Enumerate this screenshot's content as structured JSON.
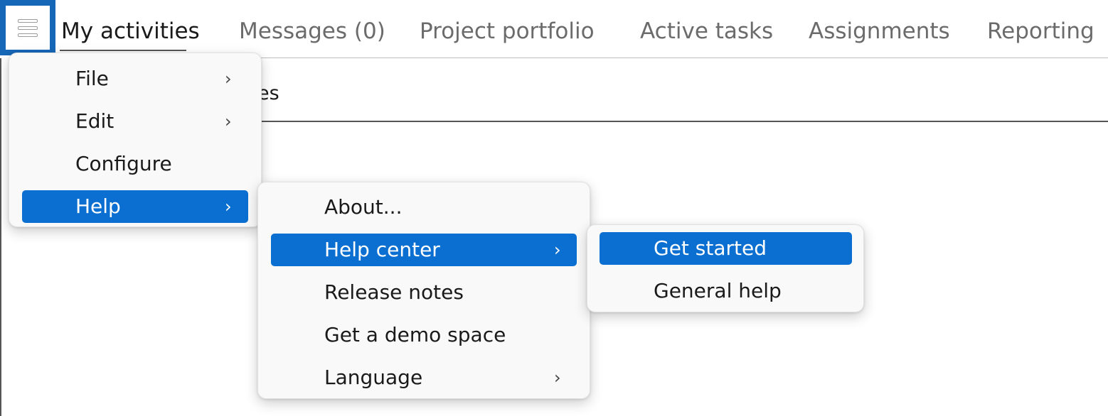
{
  "menu_button": {
    "icon": "hamburger-menu-icon"
  },
  "tabs": [
    {
      "label": "My activities"
    },
    {
      "label": "Messages (0)"
    },
    {
      "label": "Project portfolio"
    },
    {
      "label": "Active tasks"
    },
    {
      "label": "Assignments"
    },
    {
      "label": "Reporting"
    }
  ],
  "content": {
    "subtitle_fragment": "es"
  },
  "main_menu": {
    "items": [
      {
        "label": "File",
        "submenu": true
      },
      {
        "label": "Edit",
        "submenu": true
      },
      {
        "label": "Configure",
        "submenu": false
      },
      {
        "label": "Help",
        "submenu": true,
        "selected": true
      }
    ]
  },
  "help_menu": {
    "items": [
      {
        "label": "About...",
        "submenu": false
      },
      {
        "label": "Help center",
        "submenu": true,
        "selected": true
      },
      {
        "label": "Release notes",
        "submenu": false
      },
      {
        "label": "Get a demo space",
        "submenu": false
      },
      {
        "label": "Language",
        "submenu": true
      }
    ]
  },
  "help_center_menu": {
    "items": [
      {
        "label": "Get started",
        "selected": true
      },
      {
        "label": "General help"
      }
    ]
  },
  "chevron_glyph": "›",
  "colors": {
    "accent": "#0a6fd1",
    "menu_button_frame": "#1667b8"
  }
}
